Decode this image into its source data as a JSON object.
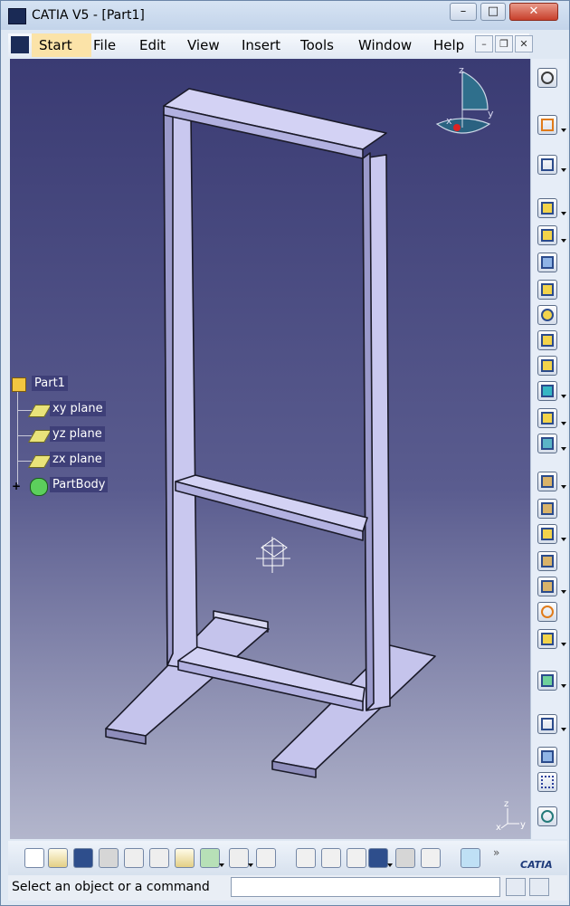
{
  "window": {
    "title": "CATIA V5 - [Part1]"
  },
  "menu": {
    "items": [
      "Start",
      "File",
      "Edit",
      "View",
      "Insert",
      "Tools",
      "Window",
      "Help"
    ]
  },
  "tree": {
    "root": "Part1",
    "children": [
      "xy plane",
      "yz plane",
      "zx plane",
      "PartBody"
    ]
  },
  "compass": {
    "axes": [
      "z",
      "y",
      "x"
    ]
  },
  "mini_axis": {
    "labels": [
      "z",
      "x",
      "y"
    ]
  },
  "bottom_logo": "CATIA",
  "status": {
    "prompt": "Select an object or a command",
    "command_value": ""
  },
  "colors": {
    "viewport_top": "#3a3b73",
    "viewport_bottom": "#b3b6cc",
    "part_fill": "#b6b5e6",
    "tree_bg": "#3e3f78"
  }
}
